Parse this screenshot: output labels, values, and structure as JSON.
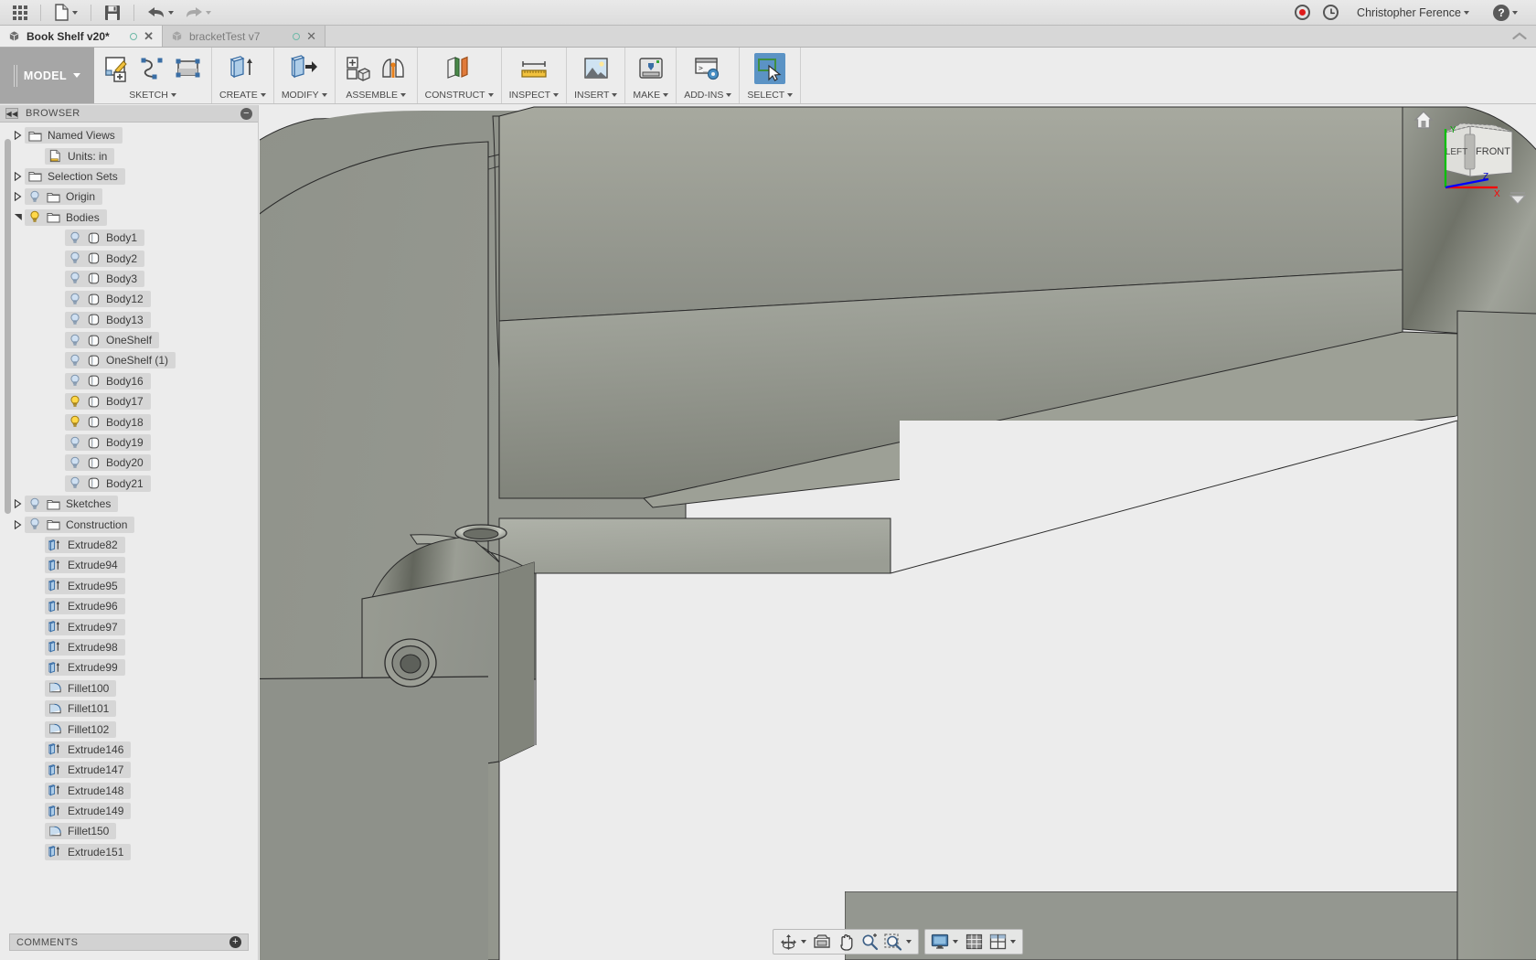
{
  "app_bar": {
    "grid_icon": "apps-grid-icon",
    "new_label": "new-document",
    "save_label": "save",
    "undo_label": "undo",
    "redo_label": "redo",
    "record_icon": "record-icon",
    "history_icon": "job-status-clock-icon",
    "user_name": "Christopher Ference",
    "help_icon": "help-icon"
  },
  "doc_tabs": [
    {
      "title": "Book Shelf v20*",
      "active": true,
      "status_icon": "sync-circle-icon",
      "close_icon": "close-icon"
    },
    {
      "title": "bracketTest v7",
      "active": false,
      "status_icon": "sync-circle-icon",
      "close_icon": "close-icon"
    }
  ],
  "ribbon": {
    "workspace": "MODEL",
    "groups": [
      {
        "label": "SKETCH",
        "dropdown": true,
        "icons": [
          "create-sketch-icon",
          "spline-icon",
          "rectangle-icon"
        ]
      },
      {
        "label": "CREATE",
        "dropdown": true,
        "icons": [
          "extrude-icon"
        ]
      },
      {
        "label": "MODIFY",
        "dropdown": true,
        "icons": [
          "press-pull-icon"
        ]
      },
      {
        "label": "ASSEMBLE",
        "dropdown": true,
        "icons": [
          "new-component-icon",
          "joint-icon"
        ]
      },
      {
        "label": "CONSTRUCT",
        "dropdown": true,
        "icons": [
          "offset-plane-icon"
        ]
      },
      {
        "label": "INSPECT",
        "dropdown": true,
        "icons": [
          "measure-ruler-icon"
        ]
      },
      {
        "label": "INSERT",
        "dropdown": true,
        "icons": [
          "insert-image-icon"
        ]
      },
      {
        "label": "MAKE",
        "dropdown": true,
        "icons": [
          "3d-print-icon"
        ]
      },
      {
        "label": "ADD-INS",
        "dropdown": true,
        "icons": [
          "scripts-addins-icon"
        ]
      },
      {
        "label": "SELECT",
        "dropdown": true,
        "icons": [
          "select-cursor-icon"
        ],
        "selected": true
      }
    ]
  },
  "browser": {
    "title": "BROWSER",
    "collapse_icon": "collapse-left-icon",
    "minimize_icon": "minimize-icon",
    "tree": [
      {
        "label": "Named Views",
        "type": "folder",
        "twisty": "closed",
        "indent": 1,
        "bulb": "none"
      },
      {
        "label": "Units: in",
        "type": "units",
        "twisty": "none",
        "indent": 2,
        "bulb": "none"
      },
      {
        "label": "Selection Sets",
        "type": "folder",
        "twisty": "closed",
        "indent": 1,
        "bulb": "none"
      },
      {
        "label": "Origin",
        "type": "folder",
        "twisty": "closed",
        "indent": 1,
        "bulb": "off"
      },
      {
        "label": "Bodies",
        "type": "folder",
        "twisty": "open",
        "indent": 1,
        "bulb": "on"
      },
      {
        "label": "Body1",
        "type": "body",
        "twisty": "none",
        "indent": 3,
        "bulb": "off"
      },
      {
        "label": "Body2",
        "type": "body",
        "twisty": "none",
        "indent": 3,
        "bulb": "off"
      },
      {
        "label": "Body3",
        "type": "body",
        "twisty": "none",
        "indent": 3,
        "bulb": "off"
      },
      {
        "label": "Body12",
        "type": "body",
        "twisty": "none",
        "indent": 3,
        "bulb": "off"
      },
      {
        "label": "Body13",
        "type": "body",
        "twisty": "none",
        "indent": 3,
        "bulb": "off"
      },
      {
        "label": "OneShelf",
        "type": "body",
        "twisty": "none",
        "indent": 3,
        "bulb": "off"
      },
      {
        "label": "OneShelf (1)",
        "type": "body",
        "twisty": "none",
        "indent": 3,
        "bulb": "off"
      },
      {
        "label": "Body16",
        "type": "body",
        "twisty": "none",
        "indent": 3,
        "bulb": "off"
      },
      {
        "label": "Body17",
        "type": "body",
        "twisty": "none",
        "indent": 3,
        "bulb": "on"
      },
      {
        "label": "Body18",
        "type": "body",
        "twisty": "none",
        "indent": 3,
        "bulb": "on"
      },
      {
        "label": "Body19",
        "type": "body",
        "twisty": "none",
        "indent": 3,
        "bulb": "off"
      },
      {
        "label": "Body20",
        "type": "body",
        "twisty": "none",
        "indent": 3,
        "bulb": "off"
      },
      {
        "label": "Body21",
        "type": "body",
        "twisty": "none",
        "indent": 3,
        "bulb": "off"
      },
      {
        "label": "Sketches",
        "type": "folder",
        "twisty": "closed",
        "indent": 1,
        "bulb": "off"
      },
      {
        "label": "Construction",
        "type": "folder",
        "twisty": "closed",
        "indent": 1,
        "bulb": "off"
      },
      {
        "label": "Extrude82",
        "type": "extrude",
        "twisty": "none",
        "indent": 2,
        "bulb": "none"
      },
      {
        "label": "Extrude94",
        "type": "extrude",
        "twisty": "none",
        "indent": 2,
        "bulb": "none"
      },
      {
        "label": "Extrude95",
        "type": "extrude",
        "twisty": "none",
        "indent": 2,
        "bulb": "none"
      },
      {
        "label": "Extrude96",
        "type": "extrude",
        "twisty": "none",
        "indent": 2,
        "bulb": "none"
      },
      {
        "label": "Extrude97",
        "type": "extrude",
        "twisty": "none",
        "indent": 2,
        "bulb": "none"
      },
      {
        "label": "Extrude98",
        "type": "extrude",
        "twisty": "none",
        "indent": 2,
        "bulb": "none"
      },
      {
        "label": "Extrude99",
        "type": "extrude",
        "twisty": "none",
        "indent": 2,
        "bulb": "none"
      },
      {
        "label": "Fillet100",
        "type": "fillet",
        "twisty": "none",
        "indent": 2,
        "bulb": "none"
      },
      {
        "label": "Fillet101",
        "type": "fillet",
        "twisty": "none",
        "indent": 2,
        "bulb": "none"
      },
      {
        "label": "Fillet102",
        "type": "fillet",
        "twisty": "none",
        "indent": 2,
        "bulb": "none"
      },
      {
        "label": "Extrude146",
        "type": "extrude",
        "twisty": "none",
        "indent": 2,
        "bulb": "none"
      },
      {
        "label": "Extrude147",
        "type": "extrude",
        "twisty": "none",
        "indent": 2,
        "bulb": "none"
      },
      {
        "label": "Extrude148",
        "type": "extrude",
        "twisty": "none",
        "indent": 2,
        "bulb": "none"
      },
      {
        "label": "Extrude149",
        "type": "extrude",
        "twisty": "none",
        "indent": 2,
        "bulb": "none"
      },
      {
        "label": "Fillet150",
        "type": "fillet",
        "twisty": "none",
        "indent": 2,
        "bulb": "none"
      },
      {
        "label": "Extrude151",
        "type": "extrude",
        "twisty": "none",
        "indent": 2,
        "bulb": "none"
      }
    ]
  },
  "comments": {
    "title": "COMMENTS",
    "add_icon": "add-comment-icon"
  },
  "viewcube": {
    "home_icon": "home-icon",
    "face_left": "LEFT",
    "face_front": "FRONT",
    "axis_x": "X",
    "axis_y": "Y",
    "axis_z": "Z",
    "fit_icon": "fit-arrow-icon"
  },
  "navbar": {
    "buttons": [
      {
        "name": "orbit-icon",
        "caret": true
      },
      {
        "name": "pan-viewport-icon",
        "caret": false
      },
      {
        "name": "pan-hand-icon",
        "caret": false
      },
      {
        "name": "zoom-icon",
        "caret": false
      },
      {
        "name": "zoom-window-icon",
        "caret": true
      },
      {
        "name": "display-settings-icon",
        "caret": true
      },
      {
        "name": "grid-snaps-icon",
        "caret": false
      },
      {
        "name": "viewports-icon",
        "caret": true
      }
    ]
  },
  "colors": {
    "accent": "#5b93c5",
    "record": "#e01b1b",
    "axis_x": "#ff0000",
    "axis_y": "#00c000",
    "axis_z": "#0000ff",
    "model_body": "#8e9189",
    "canvas_bg": "#ececec"
  }
}
